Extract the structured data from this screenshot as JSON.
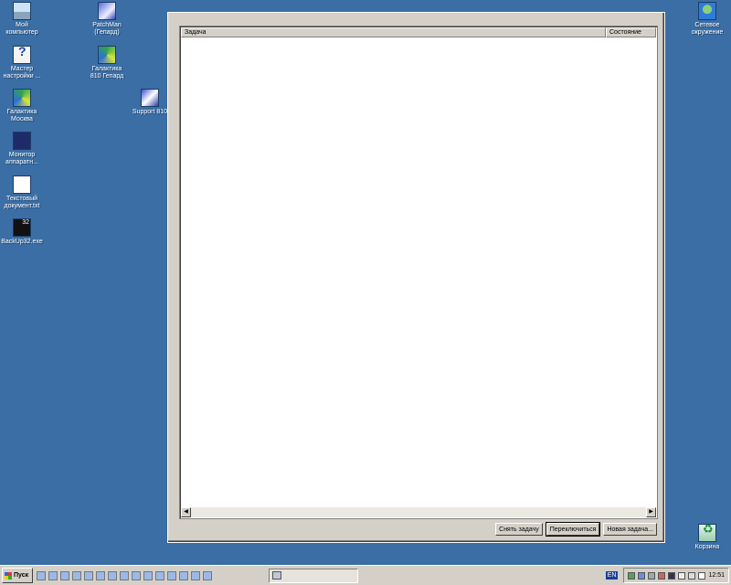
{
  "desktop": {
    "icons": [
      {
        "label": "Мой\nкомпьютер",
        "icon": "my-computer-icon"
      },
      {
        "label": "Мастер\nнастройки ...",
        "icon": "setup-wizard-icon"
      },
      {
        "label": "Галактика\nМосква",
        "icon": "galaktika-moscow-icon"
      },
      {
        "label": "Монитор\nаппаратн...",
        "icon": "hardware-monitor-icon"
      },
      {
        "label": "Текстовый\nдокумент.txt",
        "icon": "text-document-icon"
      },
      {
        "label": "BackUp32.exe",
        "icon": "backup32-icon"
      },
      {
        "label": "PatchMan\n(Гепард)",
        "icon": "patchman-icon"
      },
      {
        "label": "Галактика\n810 Гепард",
        "icon": "galaktika-810-icon"
      },
      {
        "label": "Support 810",
        "icon": "support-810-icon"
      },
      {
        "label": "Сетевое\nокружение",
        "icon": "network-neighborhood-icon"
      },
      {
        "label": "Корзина",
        "icon": "recycle-bin-icon"
      }
    ]
  },
  "task_manager": {
    "columns": {
      "task": "Задача",
      "state": "Состояние"
    },
    "buttons": {
      "end_task": "Снять задачу",
      "switch_to": "Переключиться",
      "new_task": "Новая задача..."
    }
  },
  "taskbar": {
    "start_label": "Пуск",
    "language": "EN",
    "clock": "12:51"
  }
}
